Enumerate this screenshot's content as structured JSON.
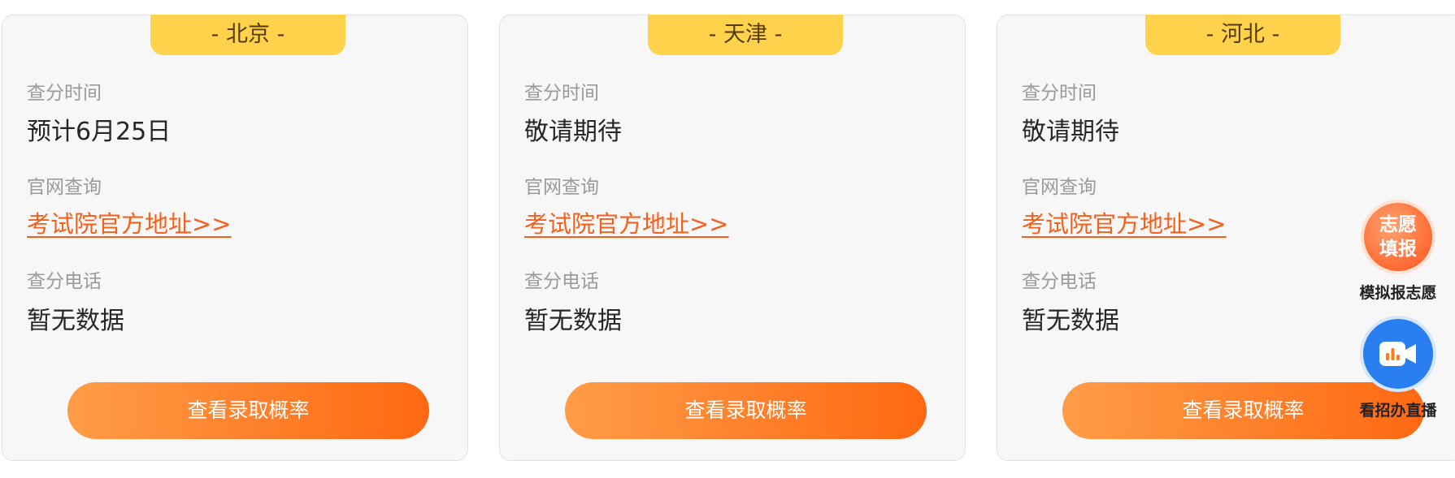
{
  "cards": [
    {
      "region": "- 北京 -",
      "score_time_label": "查分时间",
      "score_time_value": "预计6月25日",
      "site_label": "官网查询",
      "site_link": "考试院官方地址>>",
      "phone_label": "查分电话",
      "phone_value": "暂无数据",
      "button_label": "查看录取概率"
    },
    {
      "region": "- 天津 -",
      "score_time_label": "查分时间",
      "score_time_value": "敬请期待",
      "site_label": "官网查询",
      "site_link": "考试院官方地址>>",
      "phone_label": "查分电话",
      "phone_value": "暂无数据",
      "button_label": "查看录取概率"
    },
    {
      "region": "- 河北 -",
      "score_time_label": "查分时间",
      "score_time_value": "敬请期待",
      "site_label": "官网查询",
      "site_link": "考试院官方地址>>",
      "phone_label": "查分电话",
      "phone_value": "暂无数据",
      "button_label": "查看录取概率"
    }
  ],
  "floating": {
    "volunteer": {
      "icon_line1": "志愿",
      "icon_line2": "填报",
      "label": "模拟报志愿",
      "icon": "volunteer-badge-icon"
    },
    "live": {
      "label": "看招办直播",
      "icon": "video-camera-icon"
    }
  },
  "colors": {
    "tag_yellow": "#ffd24c",
    "link_orange": "#f5601d",
    "button_gradient_start": "#ff9c47",
    "button_gradient_end": "#ff6812",
    "live_blue": "#2a7ff0"
  }
}
